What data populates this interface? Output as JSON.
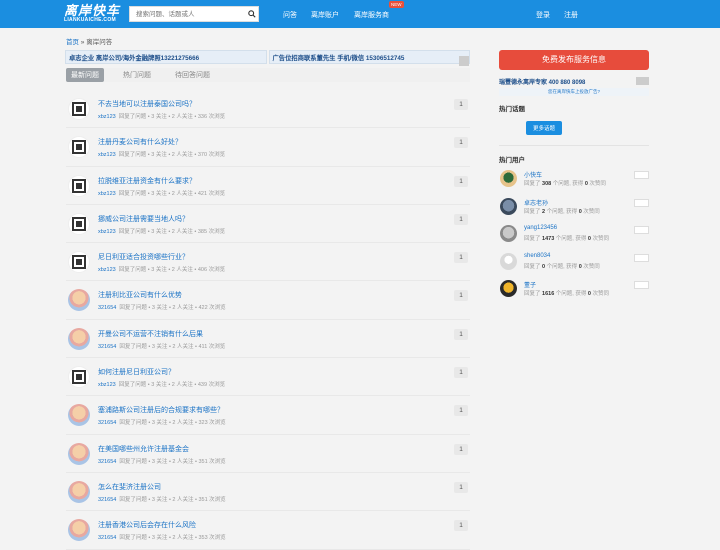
{
  "header": {
    "logo_main": "离岸快车",
    "logo_sub": "LIANKUAICHE.COM",
    "search_placeholder": "搜索问题、话题或人",
    "nav": [
      "问答",
      "离岸账户",
      "离岸服务商"
    ],
    "new_badge": "NEW",
    "login": "登录",
    "register": "注册"
  },
  "breadcrumb": {
    "home": "首页",
    "sep": " » ",
    "current": "离岸问答"
  },
  "ads": [
    "卓志企业 离岸公司/海外金融牌照13221275666",
    "广告位招商联系董先生 手机/微信 15306512745"
  ],
  "tabs": [
    "最新问题",
    "热门问题",
    "待回答问题"
  ],
  "questions": [
    {
      "title": "不去当地可以注册泰国公司吗？",
      "user": "xbz123",
      "meta": "回复了问题 • 3 关注 • 2 人关注 • 336 次浏览",
      "count": "1",
      "avatar": "qr"
    },
    {
      "title": "注册丹麦公司有什么好处？",
      "user": "xbz123",
      "meta": "回复了问题 • 3 关注 • 2 人关注 • 370 次浏览",
      "count": "1",
      "avatar": "qr"
    },
    {
      "title": "拉脱维亚注册资金有什么要求？",
      "user": "xbz123",
      "meta": "回复了问题 • 3 关注 • 2 人关注 • 421 次浏览",
      "count": "1",
      "avatar": "qr"
    },
    {
      "title": "挪威公司注册需要当地人吗？",
      "user": "xbz123",
      "meta": "回复了问题 • 3 关注 • 2 人关注 • 385 次浏览",
      "count": "1",
      "avatar": "qr"
    },
    {
      "title": "尼日利亚适合投资哪些行业？",
      "user": "xbz123",
      "meta": "回复了问题 • 3 关注 • 2 人关注 • 406 次浏览",
      "count": "1",
      "avatar": "qr"
    },
    {
      "title": "注册利比亚公司有什么优势",
      "user": "321654",
      "meta": "回复了问题 • 3 关注 • 2 人关注 • 422 次浏览",
      "count": "1",
      "avatar": "face"
    },
    {
      "title": "开曼公司不运营不注销有什么后果",
      "user": "321654",
      "meta": "回复了问题 • 3 关注 • 2 人关注 • 411 次浏览",
      "count": "1",
      "avatar": "face"
    },
    {
      "title": "如何注册尼日利亚公司？",
      "user": "xbz123",
      "meta": "回复了问题 • 3 关注 • 2 人关注 • 439 次浏览",
      "count": "1",
      "avatar": "qr"
    },
    {
      "title": "塞浦路斯公司注册后的合规要求有哪些？",
      "user": "321654",
      "meta": "回复了问题 • 3 关注 • 2 人关注 • 323 次浏览",
      "count": "1",
      "avatar": "face"
    },
    {
      "title": "在美国哪些州允许注册基金会",
      "user": "321654",
      "meta": "回复了问题 • 3 关注 • 2 人关注 • 351 次浏览",
      "count": "1",
      "avatar": "face"
    },
    {
      "title": "怎么在斐济注册公司",
      "user": "321654",
      "meta": "回复了问题 • 3 关注 • 2 人关注 • 351 次浏览",
      "count": "1",
      "avatar": "face"
    },
    {
      "title": "注册香港公司后会存在什么风险",
      "user": "321654",
      "meta": "回复了问题 • 3 关注 • 2 人关注 • 353 次浏览",
      "count": "1",
      "avatar": "face"
    }
  ],
  "sidebar": {
    "publish": "免费发布服务信息",
    "ad_title": "瑞豐德永离岸专家 400 880 8098",
    "ad_sub": "您在离岸快车上投放广告?",
    "hot_topics": "热门话题",
    "more_topics": "更多话题",
    "hot_users": "热门用户",
    "users": [
      {
        "name": "小快车",
        "stat_pre": "回复了 ",
        "answers": "308",
        "stat_mid": " 个问题, 获得 ",
        "likes": "0",
        "stat_post": " 次赞同"
      },
      {
        "name": "卓志老孙",
        "stat_pre": "回复了 ",
        "answers": "2",
        "stat_mid": " 个问题, 获得 ",
        "likes": "0",
        "stat_post": " 次赞同"
      },
      {
        "name": "yang123456",
        "stat_pre": "回复了 ",
        "answers": "1473",
        "stat_mid": " 个问题, 获得 ",
        "likes": "0",
        "stat_post": " 次赞同"
      },
      {
        "name": "shen8034",
        "stat_pre": "回复了 ",
        "answers": "0",
        "stat_mid": " 个问题, 获得 ",
        "likes": "0",
        "stat_post": " 次赞同"
      },
      {
        "name": "董子",
        "stat_pre": "回复了 ",
        "answers": "1616",
        "stat_mid": " 个问题, 获得 ",
        "likes": "0",
        "stat_post": " 次赞同"
      }
    ]
  }
}
